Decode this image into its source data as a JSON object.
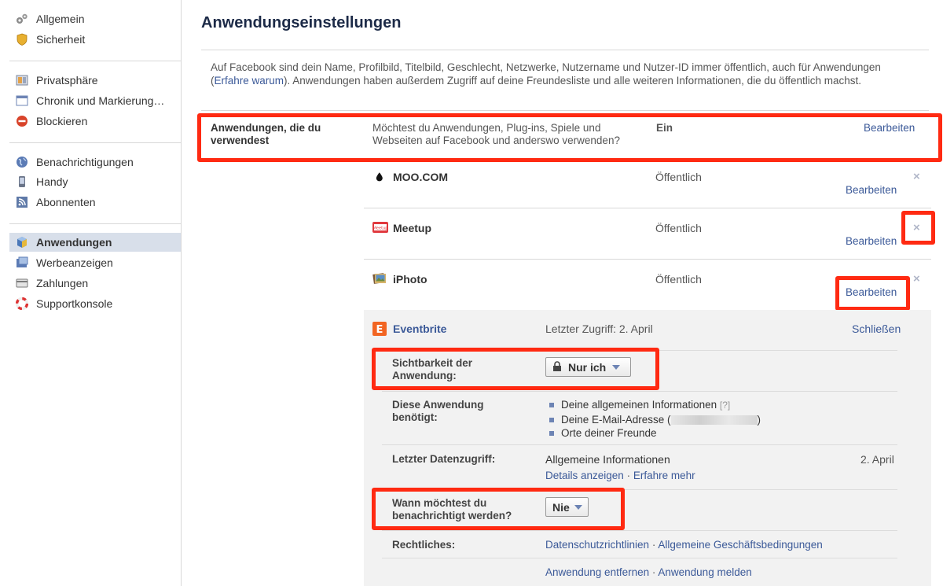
{
  "sidebar": {
    "group1": [
      {
        "icon": "gears-icon",
        "label": "Allgemein"
      },
      {
        "icon": "shield-icon",
        "label": "Sicherheit"
      }
    ],
    "group2": [
      {
        "icon": "privacy-icon",
        "label": "Privatsphäre"
      },
      {
        "icon": "timeline-icon",
        "label": "Chronik und Markierung…"
      },
      {
        "icon": "block-icon",
        "label": "Blockieren"
      }
    ],
    "group3": [
      {
        "icon": "globe-icon",
        "label": "Benachrichtigungen"
      },
      {
        "icon": "phone-icon",
        "label": "Handy"
      },
      {
        "icon": "rss-icon",
        "label": "Abonnenten"
      }
    ],
    "group4": [
      {
        "icon": "apps-icon",
        "label": "Anwendungen"
      },
      {
        "icon": "ads-icon",
        "label": "Werbeanzeigen"
      },
      {
        "icon": "payment-icon",
        "label": "Zahlungen"
      },
      {
        "icon": "lifebuoy-icon",
        "label": "Supportkonsole"
      }
    ]
  },
  "main": {
    "title": "Anwendungseinstellungen",
    "intro_part1": "Auf Facebook sind dein Name, Profilbild, Titelbild, Geschlecht, Netzwerke, Nutzername und Nutzer-ID immer öffentlich, auch für Anwendungen (",
    "intro_link": "Erfahre warum",
    "intro_part2": "). Anwendungen haben außerdem Zugriff auf deine Freundesliste und alle weiteren Informationen, die du öffentlich machst.",
    "apps_used": {
      "label": "Anwendungen, die du verwendest",
      "question": "Möchtest du Anwendungen, Plug-ins, Spiele und Webseiten auf Facebook und anderswo verwenden?",
      "status": "Ein",
      "edit": "Bearbeiten"
    },
    "apps": [
      {
        "name": "MOO.COM",
        "visibility": "Öffentlich",
        "edit": "Bearbeiten",
        "remove": "×"
      },
      {
        "name": "Meetup",
        "visibility": "Öffentlich",
        "edit": "Bearbeiten",
        "remove": "×"
      },
      {
        "name": "iPhoto",
        "visibility": "Öffentlich",
        "edit": "Bearbeiten",
        "remove": "×"
      }
    ],
    "expanded": {
      "name": "Eventbrite",
      "last_access": "Letzter Zugriff: 2. April",
      "close": "Schließen",
      "visibility_label": "Sichtbarkeit der Anwendung:",
      "visibility_value": "Nur ich",
      "needs_label": "Diese Anwendung benötigt:",
      "needs": [
        {
          "text": "Deine allgemeinen Informationen",
          "help": "[?]"
        },
        {
          "text": "Deine E-Mail-Adresse (",
          "suffix": ")"
        },
        {
          "text": "Orte deiner Freunde"
        }
      ],
      "last_data_label": "Letzter Datenzugriff:",
      "last_data_value": "Allgemeine Informationen",
      "last_data_date": "2. April",
      "details_link": "Details anzeigen",
      "learn_more_link": "Erfahre mehr",
      "dot": "·",
      "notify_label": "Wann möchtest du benachrichtigt werden?",
      "notify_value": "Nie",
      "legal_label": "Rechtliches:",
      "privacy_link": "Datenschutzrichtlinien",
      "terms_link": "Allgemeine Geschäftsbedingungen",
      "remove_link": "Anwendung entfernen",
      "report_link": "Anwendung melden"
    }
  },
  "colors": {
    "link": "#3b5998",
    "highlight": "#ff2a12",
    "active_bg": "#d8dfea"
  }
}
